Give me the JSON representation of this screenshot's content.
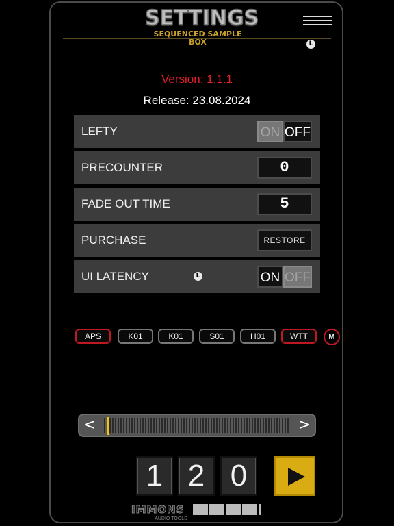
{
  "header": {
    "title": "SETTINGS",
    "subtitle": "SEQUENCED SAMPLE BOX",
    "menu_icon": "hamburger-menu-icon",
    "latency_icon": "l-circle-icon",
    "latency_icon_glyph": "L"
  },
  "info": {
    "version": "Version: 1.1.1",
    "release": "Release: 23.08.2024"
  },
  "settings": {
    "lefty": {
      "label": "LEFTY",
      "on_label": "ON",
      "off_label": "OFF",
      "value": "OFF"
    },
    "precounter": {
      "label": "PRECOUNTER",
      "value": "0"
    },
    "fade_out_time": {
      "label": "FADE OUT TIME",
      "value": "5"
    },
    "purchase": {
      "label": "PURCHASE",
      "button_label": "RESTORE"
    },
    "ui_latency": {
      "label": "UI LATENCY",
      "on_label": "ON",
      "off_label": "OFF",
      "value": "ON"
    }
  },
  "chips": {
    "items": [
      "APS",
      "K01",
      "K01",
      "S01",
      "H01",
      "WTT"
    ],
    "m_label": "M"
  },
  "scrubber": {
    "left_label": "<",
    "right_label": ">",
    "position": 0.0
  },
  "tempo": {
    "digits": [
      "1",
      "2",
      "0"
    ]
  },
  "play": {
    "icon": "play-icon"
  },
  "logo": {
    "name": "IMMONS",
    "tagline": "AUDIO TOOLS"
  },
  "colors": {
    "accent_red": "#e0202a",
    "accent_gold": "#d9ac13",
    "row_bg": "#3c3c3c"
  }
}
